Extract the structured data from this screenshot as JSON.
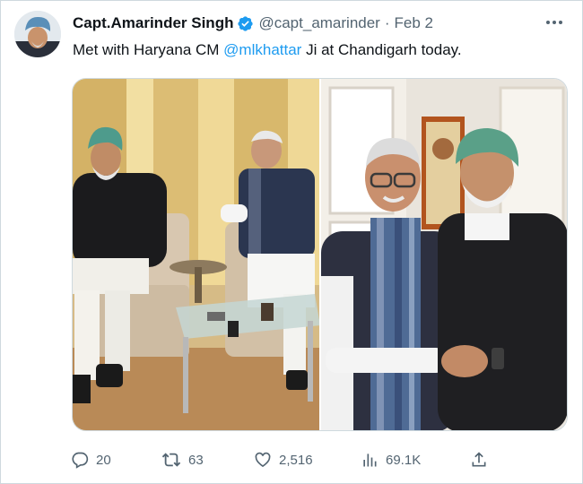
{
  "author": {
    "display_name": "Capt.Amarinder Singh",
    "handle": "@capt_amarinder",
    "separator": "·",
    "date": "Feb 2",
    "verified_icon": "verified-badge-icon",
    "avatar": "avatar"
  },
  "tweet": {
    "text_before": "Met with Haryana CM ",
    "mention": "@mlkhattar",
    "text_after": " Ji at Chandigarh today."
  },
  "media": {
    "photo_count": 2
  },
  "actions": {
    "replies": "20",
    "retweets": "63",
    "likes": "2,516",
    "views": "69.1K"
  },
  "colors": {
    "text": "#0f1419",
    "secondary": "#536471",
    "link": "#1d9bf0",
    "border": "#cfd9de"
  },
  "icons": [
    "more-icon",
    "reply-icon",
    "retweet-icon",
    "like-icon",
    "views-icon",
    "share-icon"
  ]
}
